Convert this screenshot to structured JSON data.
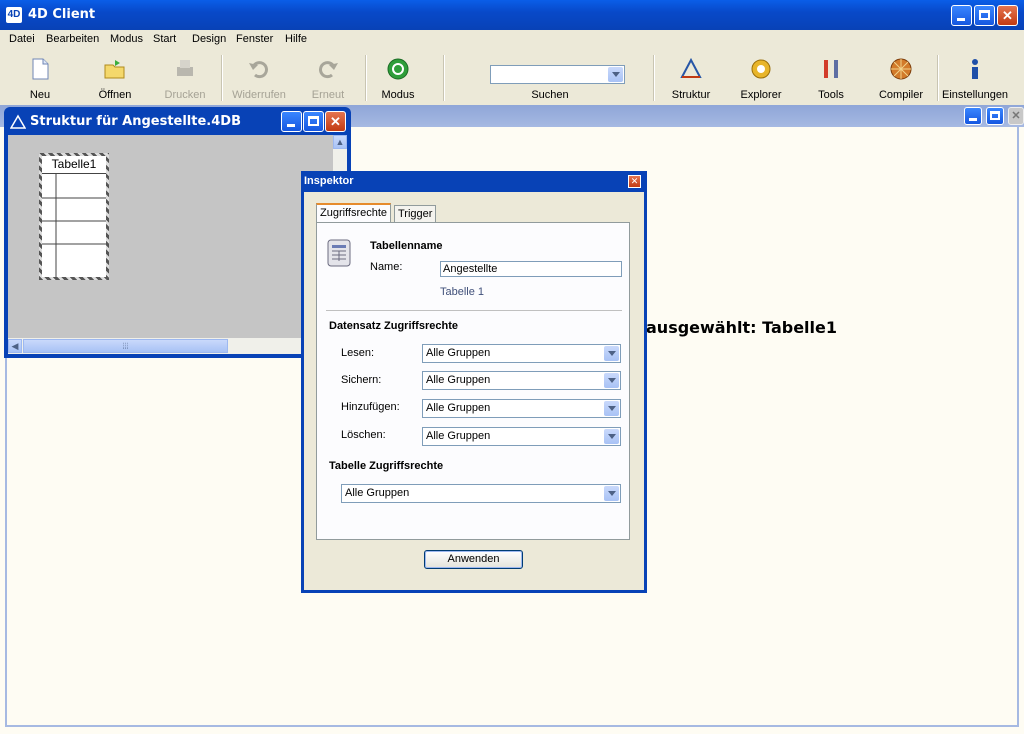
{
  "window": {
    "title": "4D Client",
    "app_icon": "4D"
  },
  "menu": [
    "Datei",
    "Bearbeiten",
    "Modus",
    "Start",
    "Design",
    "Fenster",
    "Hilfe"
  ],
  "toolbar": {
    "new": "Neu",
    "open": "Öffnen",
    "print": "Drucken",
    "undo": "Widerrufen",
    "redo": "Erneut",
    "mode": "Modus",
    "search": "Suchen",
    "search_value": "",
    "structure": "Struktur",
    "explorer": "Explorer",
    "tools": "Tools",
    "compiler": "Compiler",
    "settings": "Einstellungen"
  },
  "main": {
    "selected_text": "ausgewählt: Tabelle1"
  },
  "structure_window": {
    "title": "Struktur für Angestellte.4DB",
    "table_name": "Tabelle1"
  },
  "inspector": {
    "title": "Inspektor",
    "tabs": [
      "Zugriffsrechte",
      "Trigger"
    ],
    "table_name_heading": "Tabellenname",
    "name_label": "Name:",
    "name_value": "Angestellte",
    "table_number": "Tabelle 1",
    "record_rights_heading": "Datensatz Zugriffsrechte",
    "rights": [
      {
        "label": "Lesen:",
        "value": "Alle Gruppen"
      },
      {
        "label": "Sichern:",
        "value": "Alle Gruppen"
      },
      {
        "label": "Hinzufügen:",
        "value": "Alle Gruppen"
      },
      {
        "label": "Löschen:",
        "value": "Alle Gruppen"
      }
    ],
    "table_rights_heading": "Tabelle Zugriffsrechte",
    "table_rights_value": "Alle Gruppen",
    "apply": "Anwenden"
  }
}
